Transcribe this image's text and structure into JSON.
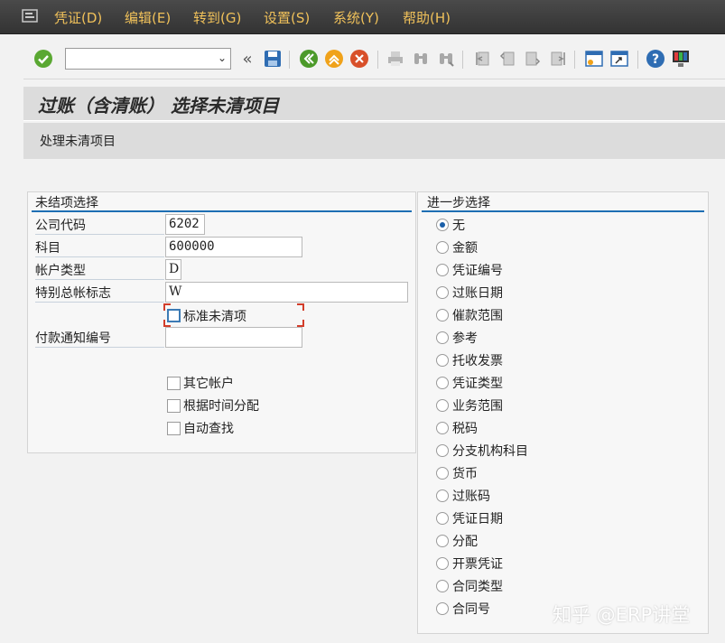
{
  "menubar": {
    "items": [
      "凭证(D)",
      "编辑(E)",
      "转到(G)",
      "设置(S)",
      "系统(Y)",
      "帮助(H)"
    ]
  },
  "toolbar": {
    "command_value": "",
    "icons": [
      "enter-icon",
      "back-icon",
      "save-icon",
      "back-green-icon",
      "exit-icon",
      "cancel-icon",
      "print-icon",
      "find-icon",
      "find-next-icon",
      "first-page-icon",
      "previous-page-icon",
      "next-page-icon",
      "last-page-icon",
      "new-session-icon",
      "shortcut-icon",
      "help-icon",
      "customize-layout-icon"
    ]
  },
  "title": "过账（含清账） 选择未清项目",
  "app_toolbar": {
    "button": "处理未清项目"
  },
  "open_items": {
    "title": "未结项选择",
    "fields": [
      {
        "label": "公司代码",
        "value": "6202"
      },
      {
        "label": "科目",
        "value": "600000"
      },
      {
        "label": "帐户类型",
        "value": "D"
      },
      {
        "label": "特别总帐标志",
        "value": "W"
      }
    ],
    "standard_open_items_label": "标准未清项",
    "payment_advice_label": "付款通知编号",
    "payment_advice_value": "",
    "checkboxes": [
      "其它帐户",
      "根据时间分配",
      "自动查找"
    ]
  },
  "further_selection": {
    "title": "进一步选择",
    "options": [
      "无",
      "金额",
      "凭证编号",
      "过账日期",
      "催款范围",
      "参考",
      "托收发票",
      "凭证类型",
      "业务范围",
      "税码",
      "分支机构科目",
      "货币",
      "过账码",
      "凭证日期",
      "分配",
      "开票凭证",
      "合同类型",
      "合同号"
    ],
    "selected_index": 0
  },
  "watermark": "知乎 @ERP讲堂",
  "colors": {
    "menubar": "#3b3b3b",
    "menu_text": "#f0c15a",
    "accent": "#1e6fb3",
    "focus": "#d23d2a"
  }
}
